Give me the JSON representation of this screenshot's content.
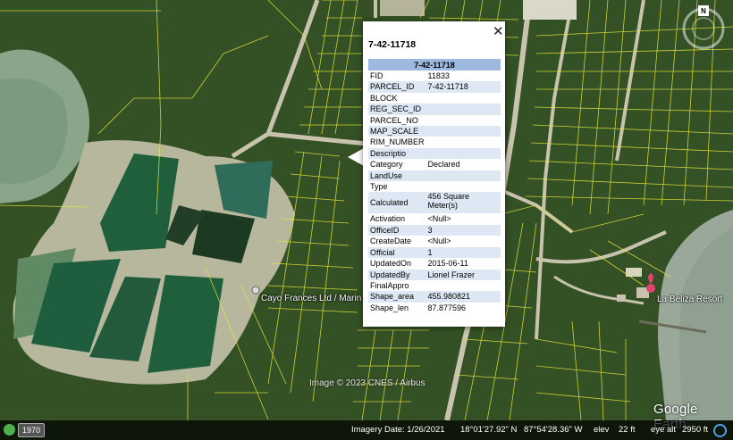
{
  "popup": {
    "title": "7-42-11718",
    "table_header": "7-42-11718",
    "close_glyph": "✕",
    "rows": [
      {
        "key": "FID",
        "value": "11833"
      },
      {
        "key": "PARCEL_ID",
        "value": "7-42-11718"
      },
      {
        "key": "BLOCK",
        "value": ""
      },
      {
        "key": "REG_SEC_ID",
        "value": ""
      },
      {
        "key": "PARCEL_NO",
        "value": ""
      },
      {
        "key": "MAP_SCALE",
        "value": ""
      },
      {
        "key": "RIM_NUMBER",
        "value": ""
      },
      {
        "key": "Descriptio",
        "value": ""
      },
      {
        "key": "Category",
        "value": "Declared"
      },
      {
        "key": "LandUse",
        "value": ""
      },
      {
        "key": "Type",
        "value": ""
      },
      {
        "key": "Calculated",
        "value": "456 Square Meter(s)"
      },
      {
        "key": "Activation",
        "value": "<Null>"
      },
      {
        "key": "OfficeID",
        "value": "3"
      },
      {
        "key": "CreateDate",
        "value": "<Null>"
      },
      {
        "key": "Official",
        "value": "1"
      },
      {
        "key": "UpdatedOn",
        "value": "2015-06-11"
      },
      {
        "key": "UpdatedBy",
        "value": "Lionel Frazer"
      },
      {
        "key": "FinalAppro",
        "value": ""
      },
      {
        "key": "Shape_area",
        "value": "455.980821"
      },
      {
        "key": "Shape_len",
        "value": "87.877596"
      }
    ]
  },
  "map": {
    "place_labels": [
      "Cayo Frances Ltd / Marin",
      "La Beliza Resort"
    ],
    "attribution": "Image © 2023 CNES / Airbus",
    "logo": "Google Earth",
    "compass_north": "N",
    "colors": {
      "parcel_lines": "#e8e83a",
      "water_ponds": "#1f5f3c",
      "vegetation": "#2f4a22",
      "sea": "#9aa89a"
    }
  },
  "statusbar": {
    "historical_year": "1970",
    "imagery_date": "Imagery Date: 1/26/2021",
    "latitude": "18°01'27.92\" N",
    "longitude": "87°54'28.36\" W",
    "elev_label": "elev",
    "elev_value": "22 ft",
    "eye_alt_label": "eye alt",
    "eye_alt_value": "2950 ft"
  }
}
